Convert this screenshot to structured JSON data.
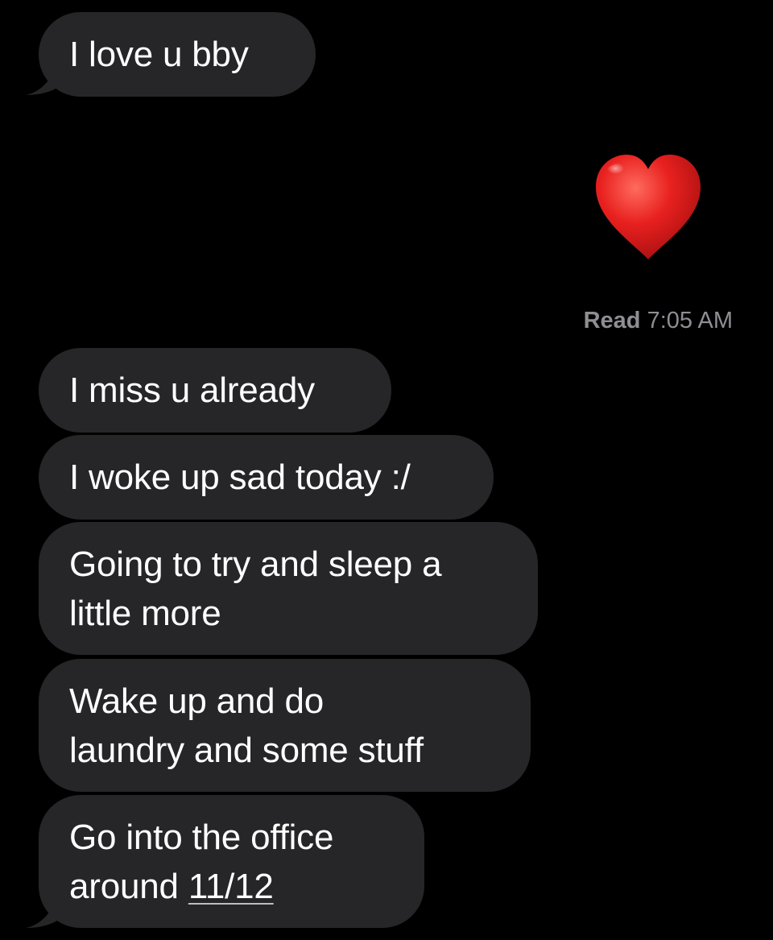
{
  "conversation": {
    "messages": [
      {
        "direction": "incoming",
        "lines": [
          "I love u bby"
        ]
      },
      {
        "direction": "outgoing",
        "content": "heart",
        "icon": "red-heart-emoji-icon"
      },
      {
        "direction": "incoming",
        "lines": [
          "I miss u already"
        ]
      },
      {
        "direction": "incoming",
        "lines": [
          "I woke up sad today :/"
        ]
      },
      {
        "direction": "incoming",
        "lines": [
          "Going to try and sleep a",
          "little more"
        ]
      },
      {
        "direction": "incoming",
        "lines": [
          "Wake up and do",
          "laundry and some stuff"
        ]
      },
      {
        "direction": "incoming",
        "lines": [
          "Go into the office",
          "around "
        ],
        "link_text": "11/12"
      }
    ],
    "read_receipt": {
      "label": "Read",
      "time": "7:05 AM"
    }
  },
  "colors": {
    "background": "#000000",
    "incoming_bubble": "#262628",
    "text": "#ffffff",
    "receipt_text": "#8e8e93",
    "heart": "#e8211f"
  }
}
